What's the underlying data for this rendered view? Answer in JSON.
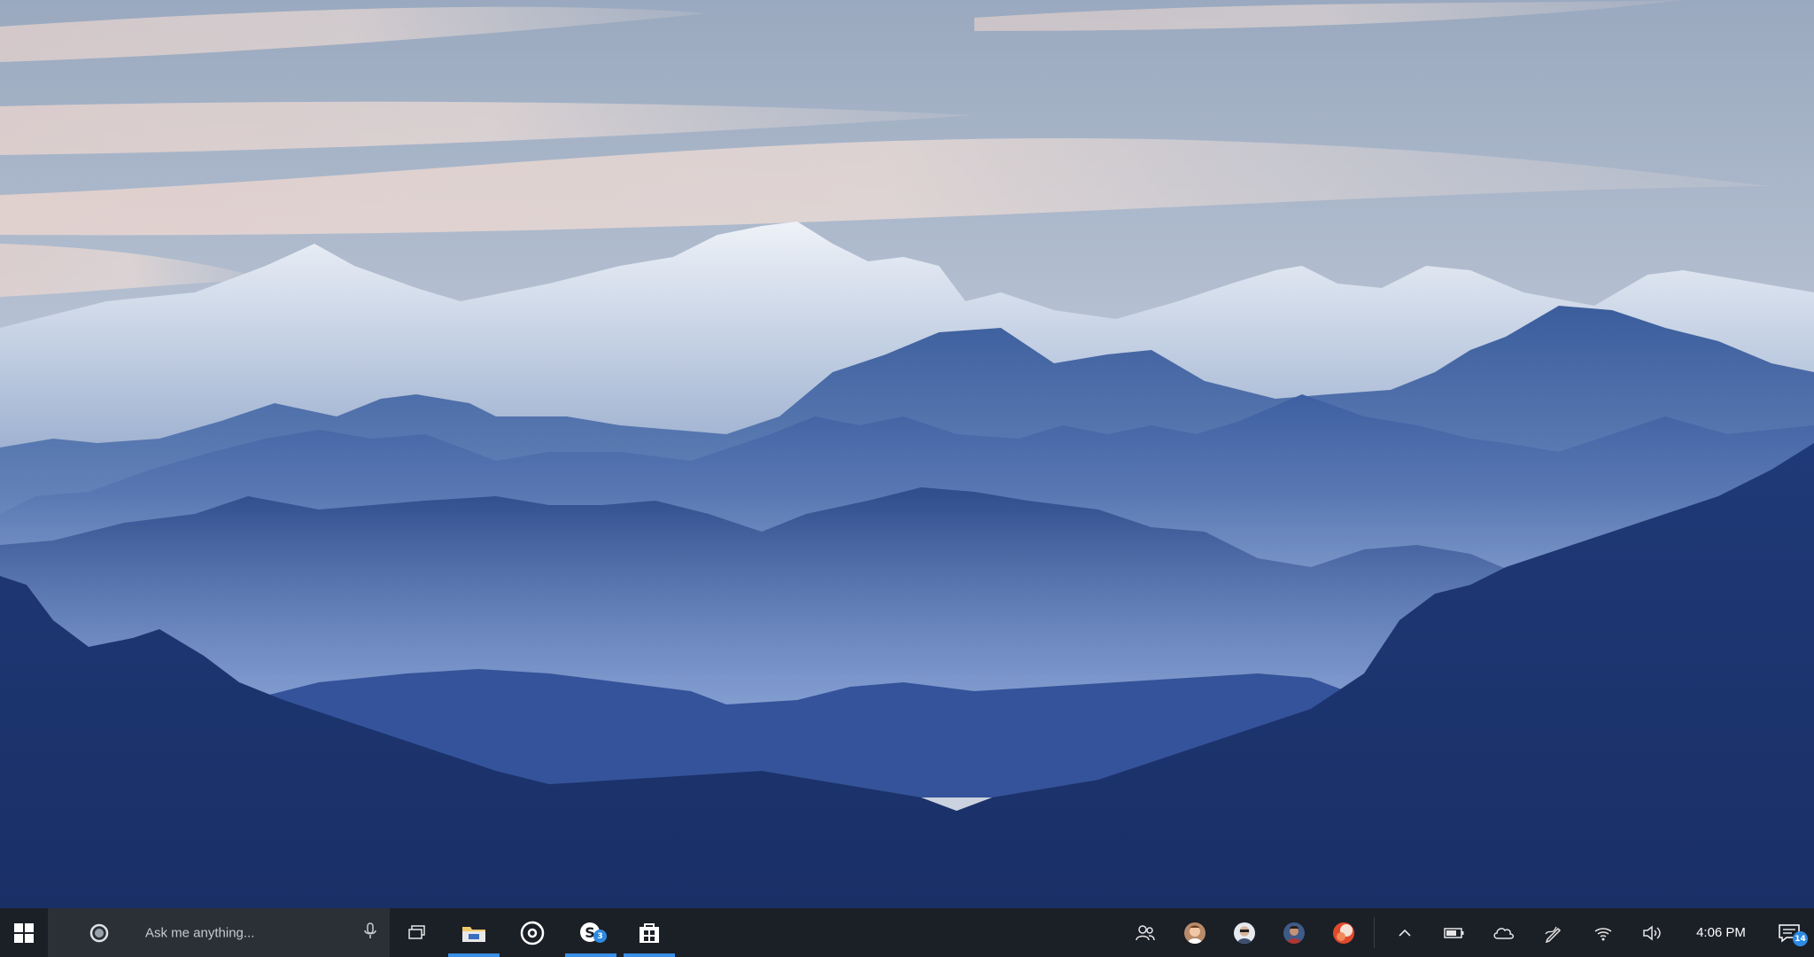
{
  "taskbar": {
    "background": "#1b1f26",
    "accent": "#3a8ee6",
    "search": {
      "placeholder": "Ask me anything..."
    },
    "pinned_apps": [
      {
        "name": "File Explorer",
        "icon": "folder-icon",
        "running": true
      },
      {
        "name": "Groove Music",
        "icon": "music-disc-icon",
        "running": false
      },
      {
        "name": "Skype",
        "icon": "skype-icon",
        "running": true,
        "badge": "3"
      },
      {
        "name": "Store",
        "icon": "store-icon",
        "running": true
      }
    ],
    "tray": {
      "people_icon": "people-icon",
      "contacts": [
        "contact-avatar-1",
        "contact-avatar-2",
        "contact-avatar-3",
        "contact-avatar-4"
      ],
      "icons": [
        "chevron-up-icon",
        "battery-icon",
        "onedrive-cloud-icon",
        "pen-icon",
        "wifi-icon",
        "volume-icon"
      ],
      "clock": "4:06 PM",
      "notification_count": "14"
    }
  }
}
